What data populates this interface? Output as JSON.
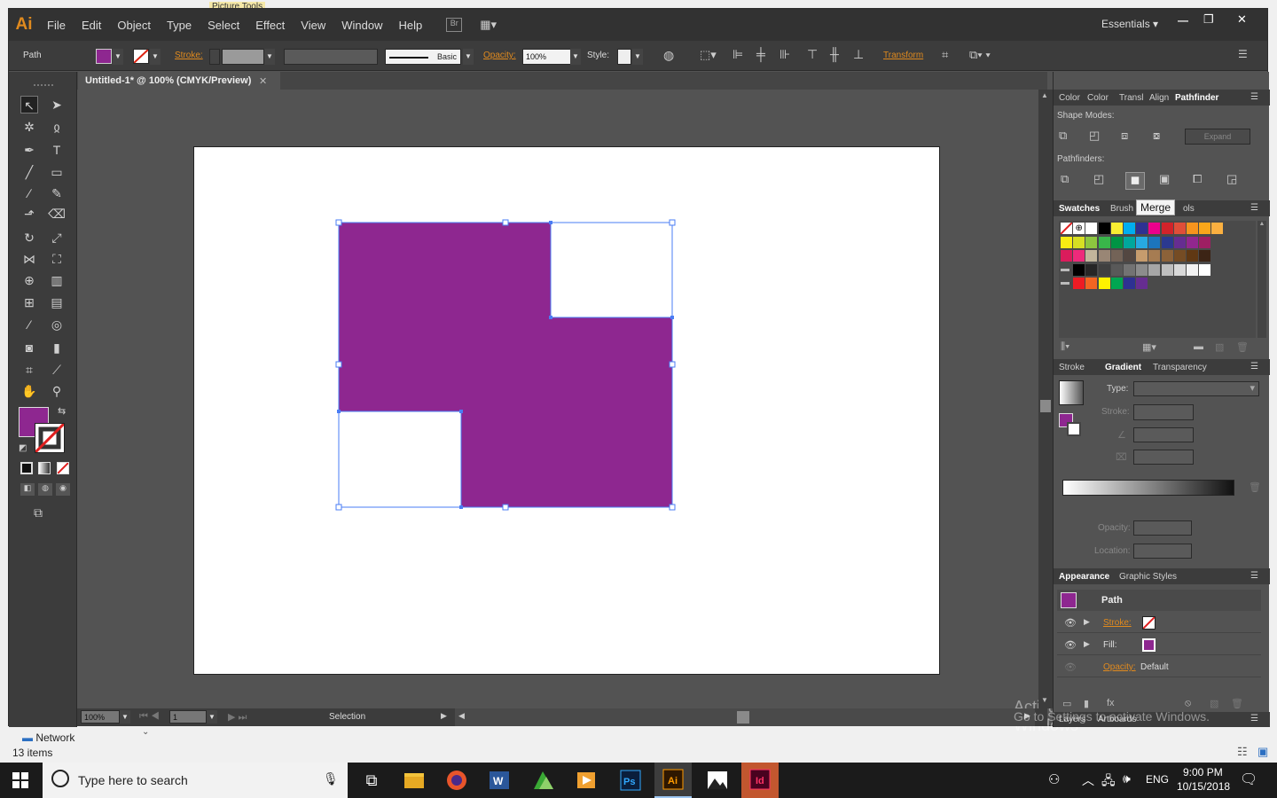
{
  "app": {
    "logo": "Ai",
    "workspace": "Essentials",
    "window_controls": {
      "minimize": "—",
      "restore": "❐",
      "close": "✕"
    }
  },
  "menu": [
    "File",
    "Edit",
    "Object",
    "Type",
    "Select",
    "Effect",
    "View",
    "Window",
    "Help"
  ],
  "top_buttons": {
    "bridge": "Br"
  },
  "ribbon_hint": "Picture Tools",
  "control": {
    "selection": "Path",
    "stroke_label": "Stroke:",
    "brush": "Basic",
    "opacity_label": "Opacity:",
    "opacity_value": "100%",
    "style_label": "Style:",
    "transform": "Transform"
  },
  "document": {
    "tab": "Untitled-1* @ 100% (CMYK/Preview)",
    "close": "✕"
  },
  "status": {
    "zoom": "100%",
    "artboard": "1",
    "tool": "Selection"
  },
  "tools": {
    "fill_color": "#8e2790",
    "stroke_none": true
  },
  "panels": {
    "top_tabs": [
      "Color",
      "Color",
      "Transl",
      "Align",
      "Pathfinder"
    ],
    "shape_modes": "Shape Modes:",
    "expand": "Expand",
    "pathfinders": "Pathfinders:",
    "swatches_tabs": [
      "Swatches",
      "Brush",
      "ols"
    ],
    "tooltip": "Merge",
    "gradient_tabs": [
      "Stroke",
      "Gradient",
      "Transparency"
    ],
    "gradient": {
      "type_label": "Type:",
      "stroke_label": "Stroke:",
      "opacity_label": "Opacity:",
      "location_label": "Location:"
    },
    "appearance_tabs": [
      "Appearance",
      "Graphic Styles"
    ],
    "appearance": {
      "title": "Path",
      "stroke": "Stroke:",
      "fill": "Fill:",
      "opacity": "Opacity:",
      "opacity_value": "Default"
    },
    "bottom_tabs": [
      "Layers",
      "Artboards"
    ]
  },
  "watermark": {
    "line1": "Activate Windows",
    "line2": "Go to Settings to activate Windows."
  },
  "explorer": {
    "network": "Network",
    "items": "13 items"
  },
  "taskbar": {
    "search": "Type here to search",
    "lang": "ENG",
    "time": "9:00 PM",
    "date": "10/15/2018"
  }
}
